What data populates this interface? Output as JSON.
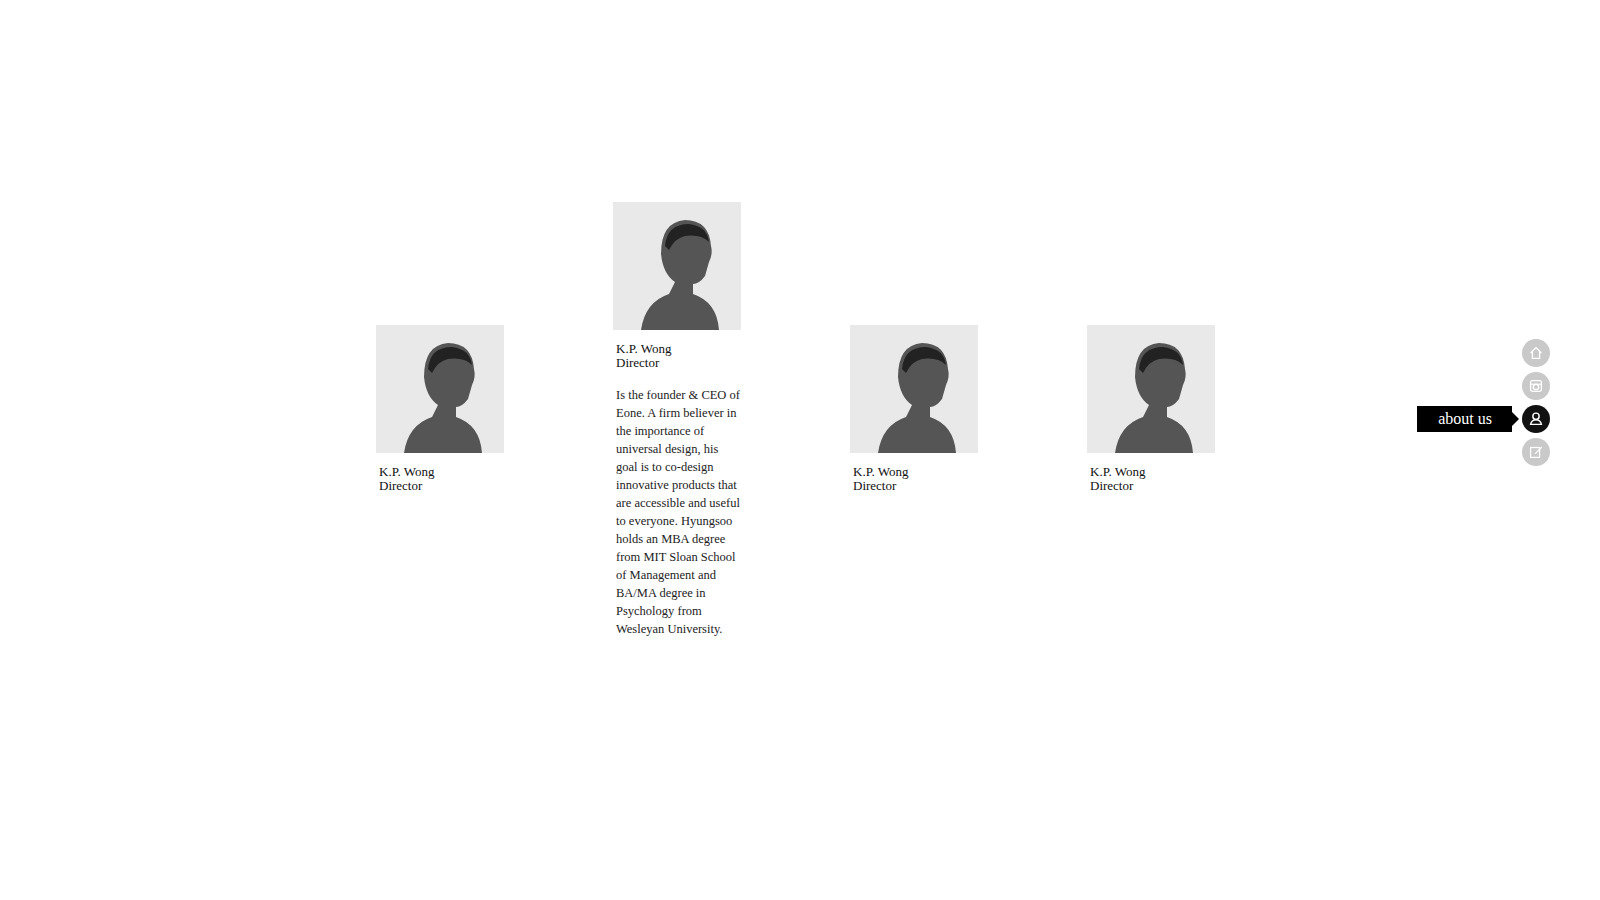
{
  "members": [
    {
      "name": "K.P. Wong",
      "role": "Director",
      "expanded": false
    },
    {
      "name": "K.P. Wong",
      "role": "Director",
      "expanded": true,
      "bio": "Is the founder & CEO of Eone. A firm believer in the importance of universal design, his goal is to co-design innovative products that are accessible and useful to everyone. Hyungsoo holds an MBA degree from MIT Sloan School of Management and BA/MA degree in Psychology from Wesleyan University."
    },
    {
      "name": "K.P. Wong",
      "role": "Director",
      "expanded": false
    },
    {
      "name": "K.P. Wong",
      "role": "Director",
      "expanded": false
    }
  ],
  "nav": [
    {
      "selected": false
    },
    {
      "selected": false
    },
    {
      "selected": true,
      "label": "about us"
    },
    {
      "selected": false
    }
  ]
}
